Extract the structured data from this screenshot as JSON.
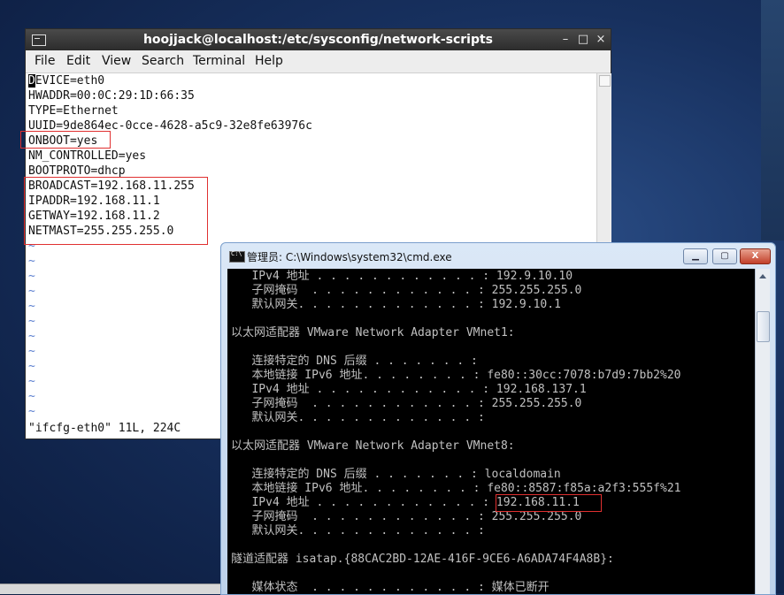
{
  "terminal": {
    "title": "hoojjack@localhost:/etc/sysconfig/network-scripts",
    "controls": {
      "minimize": "–",
      "maximize": "□",
      "close": "×"
    },
    "menu": [
      "File",
      "Edit",
      "View",
      "Search",
      "Terminal",
      "Help"
    ],
    "cursor_char": "D",
    "lines": [
      "EVICE=eth0",
      "HWADDR=00:0C:29:1D:66:35",
      "TYPE=Ethernet",
      "UUID=9de864ec-0cce-4628-a5c9-32e8fe63976c",
      "ONBOOT=yes",
      "NM_CONTROLLED=yes",
      "BOOTPROTO=dhcp",
      "BROADCAST=192.168.11.255",
      "IPADDR=192.168.11.1",
      "GETWAY=192.168.11.2",
      "NETMAST=255.255.255.0"
    ],
    "tilde": "~",
    "status": "\"ifcfg-eth0\" 11L, 224C"
  },
  "cmd": {
    "title": "管理员: C:\\Windows\\system32\\cmd.exe",
    "controls": {
      "minimize": "▁",
      "maximize": "▢",
      "close": "X"
    },
    "lines": [
      "   IPv4 地址 . . . . . . . . . . . . : 192.9.10.10",
      "   子网掩码  . . . . . . . . . . . . : 255.255.255.0",
      "   默认网关. . . . . . . . . . . . . : 192.9.10.1",
      "",
      "以太网适配器 VMware Network Adapter VMnet1:",
      "",
      "   连接特定的 DNS 后缀 . . . . . . . :",
      "   本地链接 IPv6 地址. . . . . . . . : fe80::30cc:7078:b7d9:7bb2%20",
      "   IPv4 地址 . . . . . . . . . . . . : 192.168.137.1",
      "   子网掩码  . . . . . . . . . . . . : 255.255.255.0",
      "   默认网关. . . . . . . . . . . . . :",
      "",
      "以太网适配器 VMware Network Adapter VMnet8:",
      "",
      "   连接特定的 DNS 后缀 . . . . . . . : localdomain",
      "   本地链接 IPv6 地址. . . . . . . . : fe80::8587:f85a:a2f3:555f%21",
      "   IPv4 地址 . . . . . . . . . . . . : 192.168.11.1",
      "   子网掩码  . . . . . . . . . . . . : 255.255.255.0",
      "   默认网关. . . . . . . . . . . . . :",
      "",
      "隧道适配器 isatap.{88CAC2BD-12AE-416F-9CE6-A6ADA74F4A8B}:",
      "",
      "   媒体状态  . . . . . . . . . . . . : 媒体已断开"
    ]
  },
  "colors": {
    "highlight_box": "#e03030",
    "terminal_title_bg": "#2c2c2c",
    "cmd_bg": "#000000",
    "cmd_text": "#c0c0c0",
    "vim_tilde": "#5b7fd0"
  }
}
